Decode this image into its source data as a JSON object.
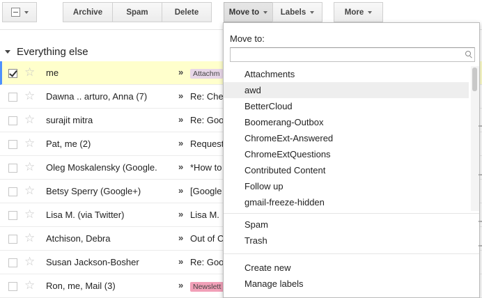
{
  "toolbar": {
    "archive": "Archive",
    "spam": "Spam",
    "delete": "Delete",
    "move_to": "Move to",
    "labels": "Labels",
    "more": "More"
  },
  "section": {
    "title": "Everything else"
  },
  "mails": [
    {
      "sender": "me",
      "subject": "",
      "chip": "Attachm",
      "chip_color": "#e8d7e8",
      "selected": true
    },
    {
      "sender": "Dawna .. arturo, Anna (7)",
      "subject": "Re: Che"
    },
    {
      "sender": "surajit mitra",
      "subject": "Re: Goo"
    },
    {
      "sender": "Pat, me (2)",
      "subject": "Request"
    },
    {
      "sender": "Oleg Moskalensky (Google.",
      "subject": "*How to"
    },
    {
      "sender": "Betsy Sperry (Google+)",
      "subject": "[Google"
    },
    {
      "sender": "Lisa M. (via Twitter)",
      "subject": "Lisa M."
    },
    {
      "sender": "Atchison, Debra",
      "subject": "Out of C"
    },
    {
      "sender": "Susan Jackson-Bosher",
      "subject": "Re: Goo"
    },
    {
      "sender": "Ron, me, Mail (3)",
      "subject": "",
      "chip": "Newslett",
      "chip_color": "#f2a0b8"
    }
  ],
  "importance_marker": "»",
  "star_glyph": "☆",
  "move_menu": {
    "title": "Move to:",
    "search_placeholder": "",
    "labels": [
      "Attachments",
      "awd",
      "BetterCloud",
      "Boomerang-Outbox",
      "ChromeExt-Answered",
      "ChromeExtQuestions",
      "Contributed Content",
      "Follow up",
      "gmail-freeze-hidden"
    ],
    "highlighted": "awd",
    "system": [
      "Spam",
      "Trash"
    ],
    "actions": [
      "Create new",
      "Manage labels"
    ]
  },
  "icons": {
    "select_all": "checkbox-icon",
    "section_toggle": "triangle-down-icon",
    "search": "search-icon"
  },
  "colors": {
    "selected_row": "#ffffcc",
    "selected_accent": "#4d90fe",
    "menu_highlight": "#eeeeee"
  }
}
